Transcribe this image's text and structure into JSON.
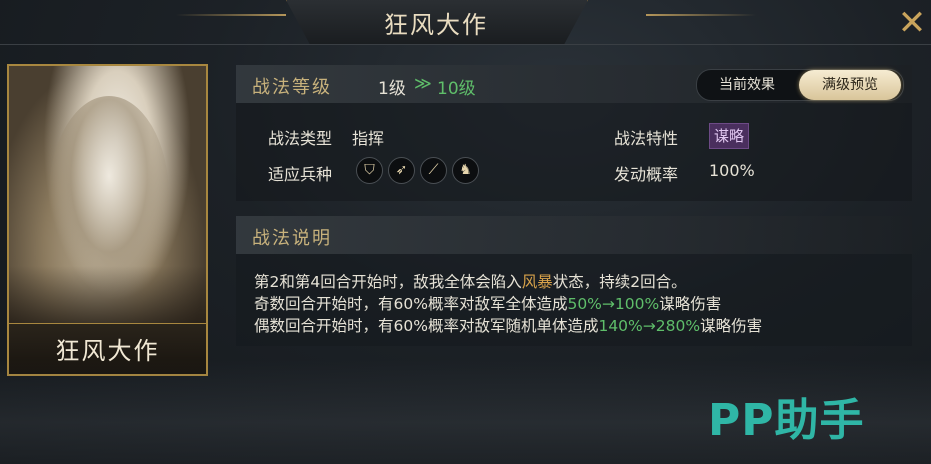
{
  "window": {
    "title": "狂风大作",
    "close_icon": "close-icon"
  },
  "card": {
    "name": "狂风大作"
  },
  "level": {
    "label": "战法等级",
    "current": "1级",
    "arrow": "≫",
    "max": "10级"
  },
  "toggle": {
    "current_effect": "当前效果",
    "max_preview": "满级预览",
    "selected": "满级预览"
  },
  "info": {
    "type_label": "战法类型",
    "type_value": "指挥",
    "troops_label": "适应兵种",
    "troop_icons": [
      "shield-icon",
      "bow-icon",
      "spear-icon",
      "horse-icon"
    ],
    "trait_label": "战法特性",
    "trait_value": "谋略",
    "rate_label": "发动概率",
    "rate_value": "100%"
  },
  "description": {
    "title": "战法说明",
    "line1_a": "第2和第4回合开始时，敌我全体会陷入",
    "line1_hl": "风暴",
    "line1_b": "状态，持续2回合。",
    "line2_a": "奇数回合开始时，有60%概率对敌军全体造成",
    "line2_hl": "50%→100%",
    "line2_b": "谋略伤害",
    "line3_a": "偶数回合开始时，有60%概率对敌军随机单体造成",
    "line3_hl": "140%→280%",
    "line3_b": "谋略伤害"
  },
  "watermark": "PP助手",
  "colors": {
    "gold": "#c8b27c",
    "green": "#5fbe6a",
    "storm": "#d8a24a",
    "trait_badge": "#4a2f5e",
    "watermark": "#2fb6a6"
  }
}
